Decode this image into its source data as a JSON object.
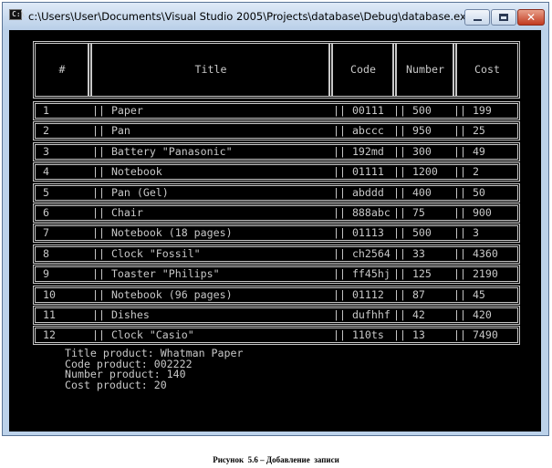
{
  "window": {
    "title": "c:\\Users\\User\\Documents\\Visual Studio 2005\\Projects\\database\\Debug\\database.exe",
    "icon_name": "console-app-icon",
    "icon_glyph": "C:\\",
    "buttons": {
      "minimize": "minimize-icon",
      "maximize": "maximize-icon",
      "close": "✕"
    }
  },
  "table": {
    "headers": [
      "#",
      "Title",
      "Code",
      "Number",
      "Cost"
    ],
    "separator": "||",
    "rows": [
      {
        "num": "1",
        "title": "Paper",
        "code": "00111",
        "number": "500",
        "cost": "199"
      },
      {
        "num": "2",
        "title": "Pan",
        "code": "abccc",
        "number": "950",
        "cost": "25"
      },
      {
        "num": "3",
        "title": "Battery \"Panasonic\"",
        "code": "192md",
        "number": "300",
        "cost": "49"
      },
      {
        "num": "4",
        "title": "Notebook",
        "code": "01111",
        "number": "1200",
        "cost": "2"
      },
      {
        "num": "5",
        "title": "Pan (Gel)",
        "code": "abddd",
        "number": "400",
        "cost": "50"
      },
      {
        "num": "6",
        "title": "Chair",
        "code": "888abc",
        "number": "75",
        "cost": "900"
      },
      {
        "num": "7",
        "title": "Notebook (18 pages)",
        "code": "01113",
        "number": "500",
        "cost": "3"
      },
      {
        "num": "8",
        "title": "Clock \"Fossil\"",
        "code": "ch2564",
        "number": "33",
        "cost": "4360"
      },
      {
        "num": "9",
        "title": "Toaster \"Philips\"",
        "code": "ff45hj",
        "number": "125",
        "cost": "2190"
      },
      {
        "num": "10",
        "title": "Notebook (96 pages)",
        "code": "01112",
        "number": "87",
        "cost": "45"
      },
      {
        "num": "11",
        "title": "Dishes",
        "code": "dufhhf",
        "number": "42",
        "cost": "420"
      },
      {
        "num": "12",
        "title": "Clock \"Casio\"",
        "code": "110ts",
        "number": "13",
        "cost": "7490"
      }
    ]
  },
  "new_record": [
    "Title product: Whatman Paper",
    "Code product: 002222",
    "Number product: 140",
    "Cost product: 20"
  ],
  "caption": "Рисунок  5.6 – Добавление  записи",
  "colors": {
    "console_bg": "#000000",
    "console_text": "#c8c8c8",
    "titlebar": "#bcd2ea",
    "close_button": "#c13a20"
  }
}
